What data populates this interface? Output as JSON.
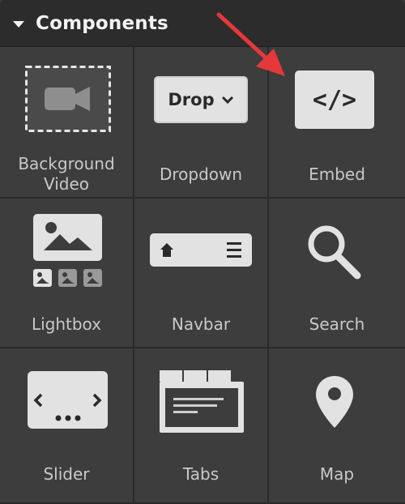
{
  "panel": {
    "title": "Components"
  },
  "items": [
    {
      "label_line1": "Background",
      "label_line2": "Video"
    },
    {
      "label": "Dropdown",
      "button_text": "Drop"
    },
    {
      "label": "Embed",
      "code_text": "</>"
    },
    {
      "label": "Lightbox"
    },
    {
      "label": "Navbar"
    },
    {
      "label": "Search"
    },
    {
      "label": "Slider"
    },
    {
      "label": "Tabs"
    },
    {
      "label": "Map"
    }
  ],
  "colors": {
    "arrow": "#e6383a",
    "panel_bg": "#3b3b3b",
    "header_bg": "#2c2c2c",
    "icon_fill": "#e0e0e0"
  }
}
